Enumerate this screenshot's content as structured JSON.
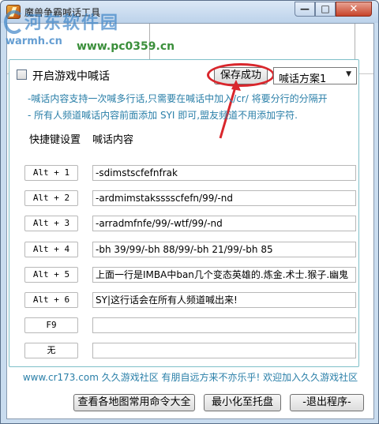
{
  "window": {
    "title": "魔兽争霸喊话工具",
    "close_glyph": "✕",
    "min_glyph": "—",
    "max_glyph": "□"
  },
  "watermark": {
    "logo": "河东软件园",
    "sub": "warmh.cn",
    "url": "www.pc0359.cn"
  },
  "settings": {
    "enable_label": "开启游戏中喊话",
    "save_label": "保存成功",
    "scheme_selected": "喊话方案1",
    "hint1": "-喊话内容支持一次喊多行话,只需要在喊话中加入/cr/ 将要分行的分隔开",
    "hint2": "- 所有人频道喊话内容前面添加 SYI 即可,盟友频道不用添加字符."
  },
  "columns": {
    "hotkey": "快捷键设置",
    "content": "喊话内容"
  },
  "rows": [
    {
      "key": "Alt + 1",
      "text": "-sdimstscfefnfrak"
    },
    {
      "key": "Alt + 2",
      "text": "-ardmimstaksssscfefn/99/-nd"
    },
    {
      "key": "Alt + 3",
      "text": "-arradmfnfe/99/-wtf/99/-nd"
    },
    {
      "key": "Alt + 4",
      "text": "-bh 39/99/-bh 88/99/-bh 21/99/-bh 85"
    },
    {
      "key": "Alt + 5",
      "text": "上面一行是IMBA中ban几个变态英雄的.炼金.术士.猴子.幽鬼"
    },
    {
      "key": "Alt + 6",
      "text": "SY|这行话会在所有人频道喊出来!"
    },
    {
      "key": "F9",
      "text": ""
    },
    {
      "key": "无",
      "text": ""
    }
  ],
  "footer": {
    "text": "www.cr173.com 久久游戏社区 有朋自远方来不亦乐乎! 欢迎加入久久游戏社区"
  },
  "buttons": {
    "commands": "查看各地图常用命令大全",
    "minimize_tray": "最小化至托盘",
    "exit": "-退出程序-"
  },
  "colors": {
    "hint": "#2a7fa8",
    "highlight": "#d9262c",
    "panel_border": "#7fbfc8"
  }
}
